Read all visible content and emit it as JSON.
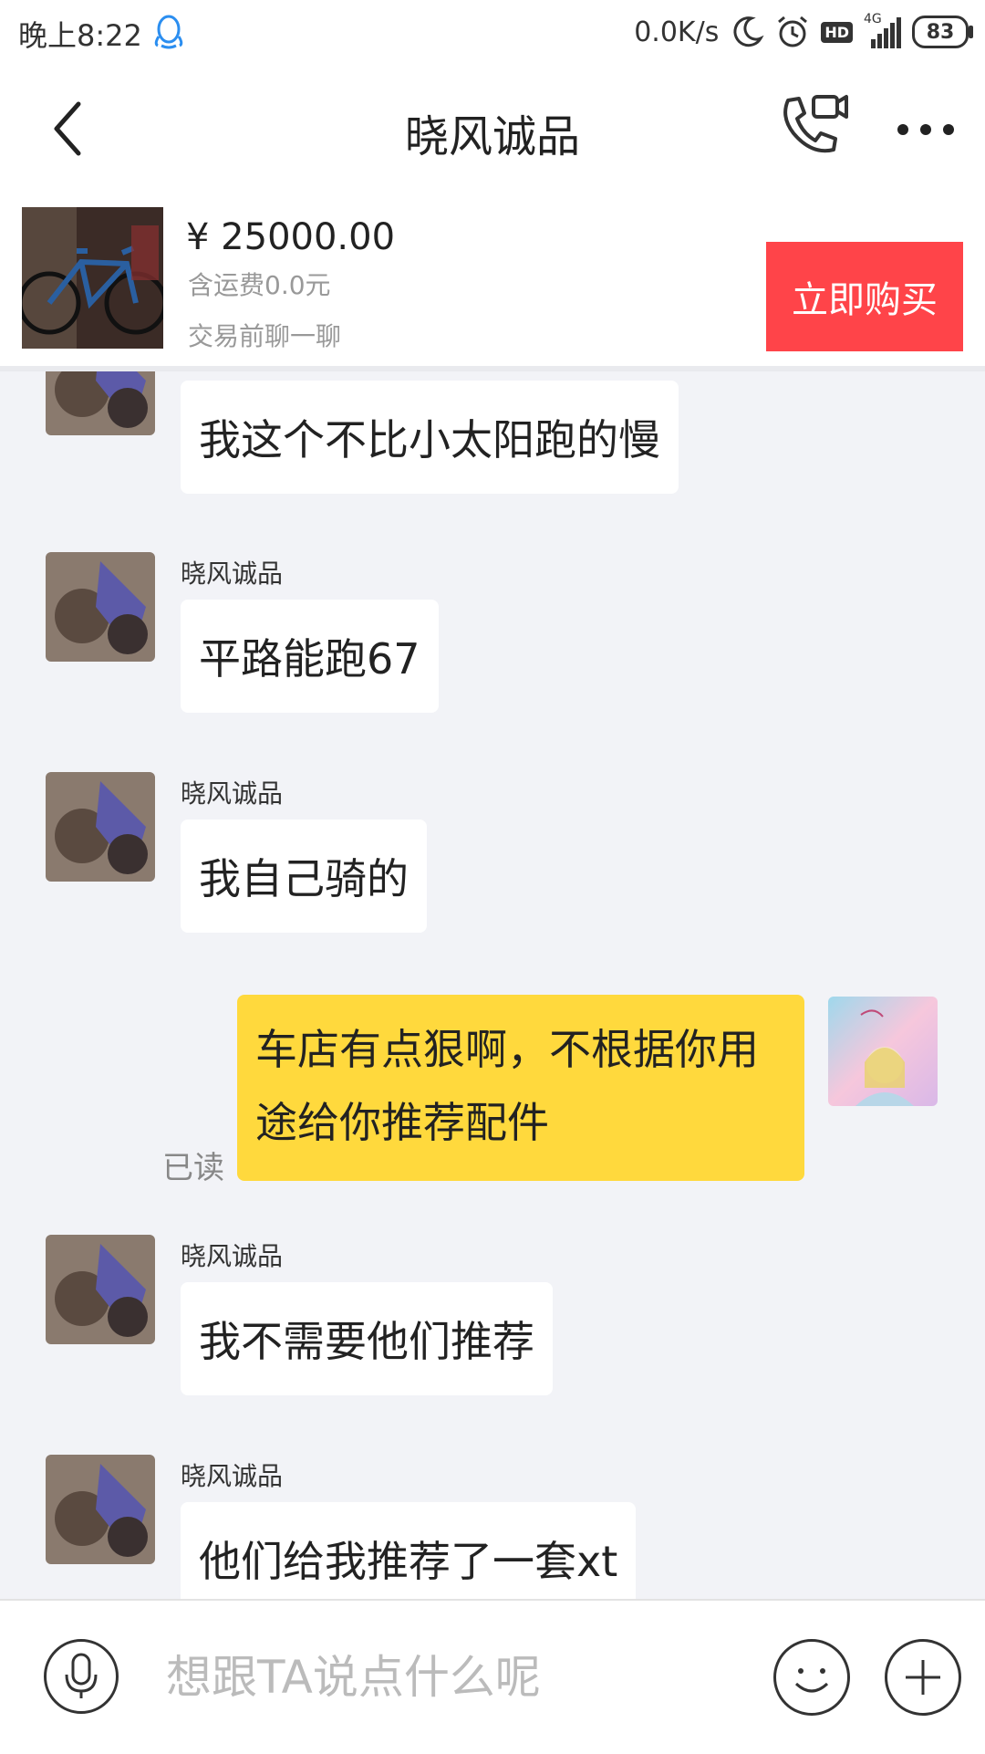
{
  "status_bar": {
    "time": "晚上8:22",
    "net_speed": "0.0K/s",
    "battery": "83",
    "hd_label": "HD",
    "network_label": "4G",
    "icons": [
      "qq-icon",
      "moon-icon",
      "alarm-icon",
      "hd-icon",
      "signal-icon",
      "battery-icon"
    ]
  },
  "header": {
    "title": "晓风诚品",
    "icons": [
      "back-icon",
      "video-call-icon",
      "more-icon"
    ]
  },
  "product": {
    "price": "¥ 25000.00",
    "shipping": "含运费0.0元",
    "chat_hint": "交易前聊一聊",
    "buy_label": "立即购买",
    "buy_color": "#ff4449"
  },
  "messages": [
    {
      "from": "other",
      "sender": "",
      "text": "我这个不比小太阳跑的慢"
    },
    {
      "from": "other",
      "sender": "晓风诚品",
      "text": "平路能跑67"
    },
    {
      "from": "other",
      "sender": "晓风诚品",
      "text": "我自己骑的"
    },
    {
      "from": "me",
      "text": "车店有点狠啊，不根据你用途给你推荐配件",
      "status": "已读"
    },
    {
      "from": "other",
      "sender": "晓风诚品",
      "text": "我不需要他们推荐"
    },
    {
      "from": "other",
      "sender": "晓风诚品",
      "text": "他们给我推荐了一套xt"
    }
  ],
  "input_bar": {
    "placeholder": "想跟TA说点什么呢",
    "icons": [
      "mic-icon",
      "emoji-icon",
      "plus-icon"
    ]
  },
  "colors": {
    "my_bubble": "#ffd93d",
    "other_bubble": "#ffffff",
    "chat_bg": "#f2f3f7"
  }
}
